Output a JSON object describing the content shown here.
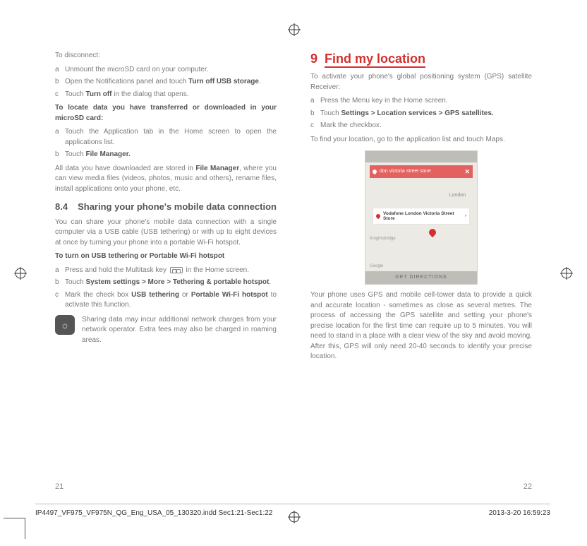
{
  "left": {
    "intro": "To disconnect:",
    "la": "Unmount the microSD card on your computer.",
    "lb_pre": "Open the Notifications panel and touch ",
    "lb_bold": "Turn off USB storage",
    "lb_post": ".",
    "lc_pre": "Touch ",
    "lc_bold": "Turn off",
    "lc_post": " in the dialog that opens.",
    "sub1": "To locate data you have transferred or downloaded in your microSD card:",
    "l2a": "Touch the Application tab in the Home screen to open the applications list.",
    "l2b_pre": "Touch ",
    "l2b_bold": "File Manager.",
    "para1_pre": "All data you have downloaded are stored in ",
    "para1_bold": "File Manager",
    "para1_post": ", where you can view media files (videos, photos, music and others), rename files, install applications onto your phone, etc.",
    "secnum": "8.4",
    "sectitle": "Sharing your phone's mobile data connection",
    "para2": "You can share your phone's mobile data connection with a single computer via a USB cable (USB tethering) or with up to eight devices at once by turning your phone into a portable Wi-Fi hotspot.",
    "sub2": "To turn on USB tethering or Portable Wi-Fi hotspot",
    "l3a_pre": "Press and hold the Multitask key ",
    "l3a_post": " in the Home screen.",
    "l3b_pre": "Touch ",
    "l3b_bold": "System settings > More > Tethering & portable hotspot",
    "l3b_post": ".",
    "l3c_pre": "Mark the check box ",
    "l3c_bold1": "USB tethering",
    "l3c_mid": " or ",
    "l3c_bold2": "Portable Wi-Fi hotspot",
    "l3c_post": " to activate this function.",
    "note": "Sharing data may incur additional network charges from your network operator. Extra fees may also be charged in roaming areas.",
    "pg": "21"
  },
  "right": {
    "chnum": "9",
    "chtitle": "Find my location",
    "intro": "To activate your phone's global positioning system (GPS) satellite Receiver:",
    "ra": "Press the Menu key in the Home screen.",
    "rb_pre": "Touch ",
    "rb_bold": "Settings > Location services > GPS satellites.",
    "rc": "Mark the checkbox.",
    "line2": "To find your location, go to the application list and touch Maps.",
    "fig": {
      "search": "don victoria street store",
      "x": "✕",
      "city": "London",
      "label": "Vodafone London Victoria Street Store",
      "chev": "›",
      "kn": "Knightsbridge",
      "google": "Google",
      "btn": "GET DIRECTIONS"
    },
    "para": "Your phone uses GPS and mobile cell-tower data to provide a quick and accurate location - sometimes as close as several metres. The process of accessing the GPS satellite and setting your phone's precise location for the first time can require up to 5 minutes. You will need to stand in a place with a clear view of the sky and avoid moving. After this, GPS will only need 20-40 seconds to identify your precise location.",
    "pg": "22"
  },
  "foot": {
    "file": "IP4497_VF975_VF975N_QG_Eng_USA_05_130320.indd   Sec1:21-Sec1:22",
    "ts": "2013-3-20   16:59:23"
  }
}
